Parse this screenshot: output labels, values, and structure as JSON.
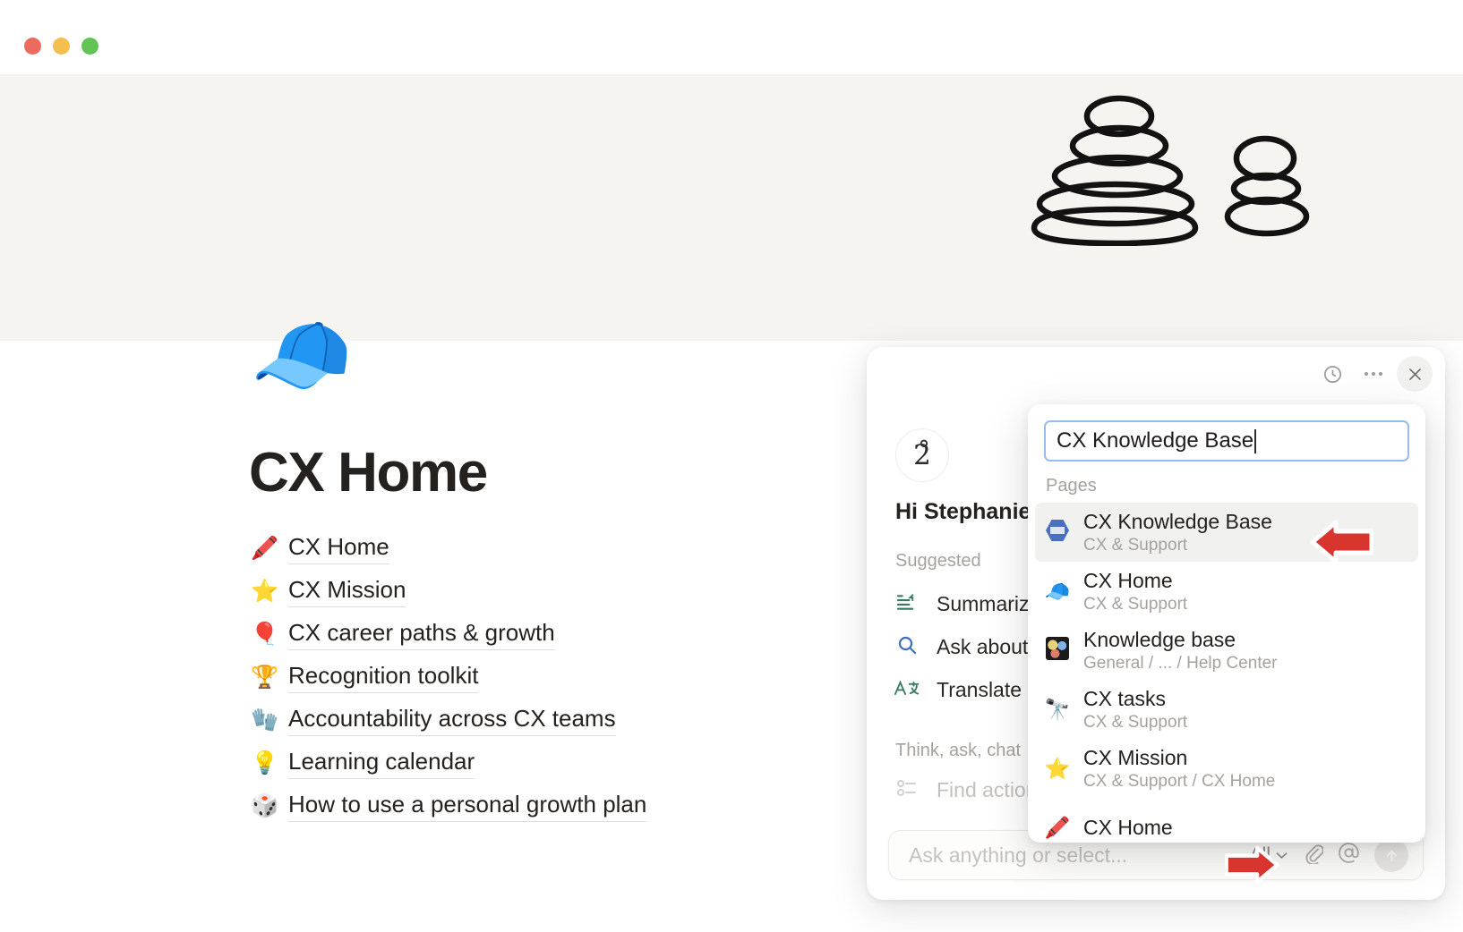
{
  "window": {
    "traffic_lights": [
      "close",
      "minimize",
      "zoom"
    ],
    "colors": {
      "close": "#ec6a5e",
      "minimize": "#f3bf4f",
      "zoom": "#61c454"
    }
  },
  "cover": {
    "illustration": "stacked-stones-cairn",
    "background": "#f5f4f0"
  },
  "page": {
    "icon": "🧢",
    "title": "CX Home",
    "links": [
      {
        "emoji": "🖍️",
        "label": "CX Home"
      },
      {
        "emoji": "⭐",
        "label": "CX Mission"
      },
      {
        "emoji": "🎈",
        "label": "CX career paths & growth"
      },
      {
        "emoji": "🏆",
        "label": "Recognition toolkit"
      },
      {
        "emoji": "🧤",
        "label": "Accountability across CX teams"
      },
      {
        "emoji": "💡",
        "label": "Learning calendar"
      },
      {
        "emoji": "🎲",
        "label": "How to use a personal growth plan"
      }
    ]
  },
  "ai_panel": {
    "avatar_glyph": "2̊",
    "greeting": "Hi Stephanie! H",
    "header_icons": [
      "history-icon",
      "more-icon",
      "close-icon"
    ],
    "suggested_label": "Suggested",
    "suggested": [
      {
        "icon": "📑",
        "label": "Summarize"
      },
      {
        "icon": "🔍",
        "label": "Ask about t"
      },
      {
        "icon": "🅰",
        "label": "Translate"
      }
    ],
    "think_label": "Think, ask, chat",
    "think_items": [
      {
        "icon": "☰",
        "label": "Find action"
      }
    ],
    "input": {
      "placeholder": "Ask anything or select...",
      "scope": "All",
      "tools": [
        "attach-icon",
        "mention-icon",
        "send-icon"
      ]
    }
  },
  "search_popup": {
    "query": "CX Knowledge Base",
    "section_label": "Pages",
    "results": [
      {
        "icon": "notion-badge",
        "title": "CX Knowledge Base",
        "crumb": "CX & Support",
        "active": true
      },
      {
        "icon": "🧢",
        "title": "CX Home",
        "crumb": "CX & Support",
        "active": false
      },
      {
        "icon": "kb-badge",
        "title": "Knowledge base",
        "crumb": "General / ... / Help Center",
        "active": false
      },
      {
        "icon": "🔭",
        "title": "CX tasks",
        "crumb": "CX & Support",
        "active": false
      },
      {
        "icon": "⭐",
        "title": "CX Mission",
        "crumb": "CX & Support / CX Home",
        "active": false
      },
      {
        "icon": "🖍️",
        "title": "CX Home",
        "crumb": "",
        "active": false
      }
    ]
  },
  "annotations": {
    "color": "#d32f2f",
    "arrows": [
      {
        "name": "arrow-pointing-to-first-result",
        "direction": "left"
      },
      {
        "name": "arrow-pointing-to-scope-selector",
        "direction": "right"
      }
    ]
  }
}
